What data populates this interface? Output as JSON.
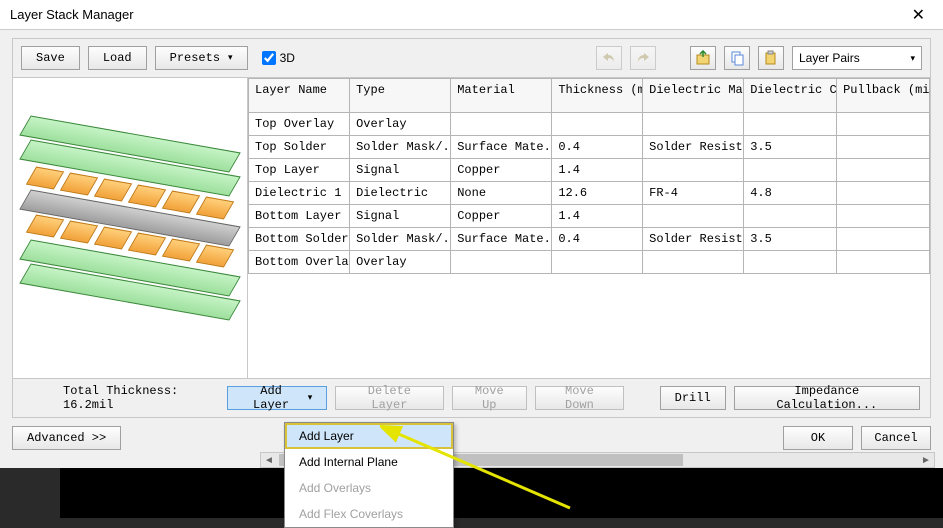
{
  "window": {
    "title": "Layer Stack Manager"
  },
  "toolbar": {
    "save": "Save",
    "load": "Load",
    "presets": "Presets",
    "three_d": "3D",
    "layer_pairs": "Layer Pairs"
  },
  "columns": [
    "Layer Name",
    "Type",
    "Material",
    "Thickness (mil)",
    "Dielectric Material",
    "Dielectric Constant",
    "Pullback (mi"
  ],
  "rows": [
    {
      "name": "Top Overlay",
      "type": "Overlay",
      "material": "",
      "thickness": "",
      "dmat": "",
      "dconst": "",
      "pull": ""
    },
    {
      "name": "Top Solder",
      "type": "Solder Mask/...",
      "material": "Surface Mate...",
      "thickness": "0.4",
      "dmat": "Solder Resist",
      "dconst": "3.5",
      "pull": ""
    },
    {
      "name": "Top Layer",
      "type": "Signal",
      "material": "Copper",
      "thickness": "1.4",
      "dmat": "",
      "dconst": "",
      "pull": ""
    },
    {
      "name": "Dielectric 1",
      "type": "Dielectric",
      "material": "None",
      "thickness": "12.6",
      "dmat": "FR-4",
      "dconst": "4.8",
      "pull": ""
    },
    {
      "name": "Bottom Layer",
      "type": "Signal",
      "material": "Copper",
      "thickness": "1.4",
      "dmat": "",
      "dconst": "",
      "pull": ""
    },
    {
      "name": "Bottom Solder",
      "type": "Solder Mask/...",
      "material": "Surface Mate...",
      "thickness": "0.4",
      "dmat": "Solder Resist",
      "dconst": "3.5",
      "pull": ""
    },
    {
      "name": "Bottom Overlay",
      "type": "Overlay",
      "material": "",
      "thickness": "",
      "dmat": "",
      "dconst": "",
      "pull": ""
    }
  ],
  "totals": {
    "label": "Total Thickness: 16.2mil"
  },
  "actions": {
    "add_layer": "Add Layer",
    "delete_layer": "Delete Layer",
    "move_up": "Move Up",
    "move_down": "Move Down",
    "drill": "Drill",
    "impedance": "Impedance Calculation..."
  },
  "footer": {
    "advanced": "Advanced >>",
    "ok": "OK",
    "cancel": "Cancel"
  },
  "menu": {
    "items": [
      "Add Layer",
      "Add Internal Plane",
      "Add Overlays",
      "Add Flex Coverlays"
    ],
    "disabled": [
      2,
      3
    ],
    "selected": 0
  }
}
